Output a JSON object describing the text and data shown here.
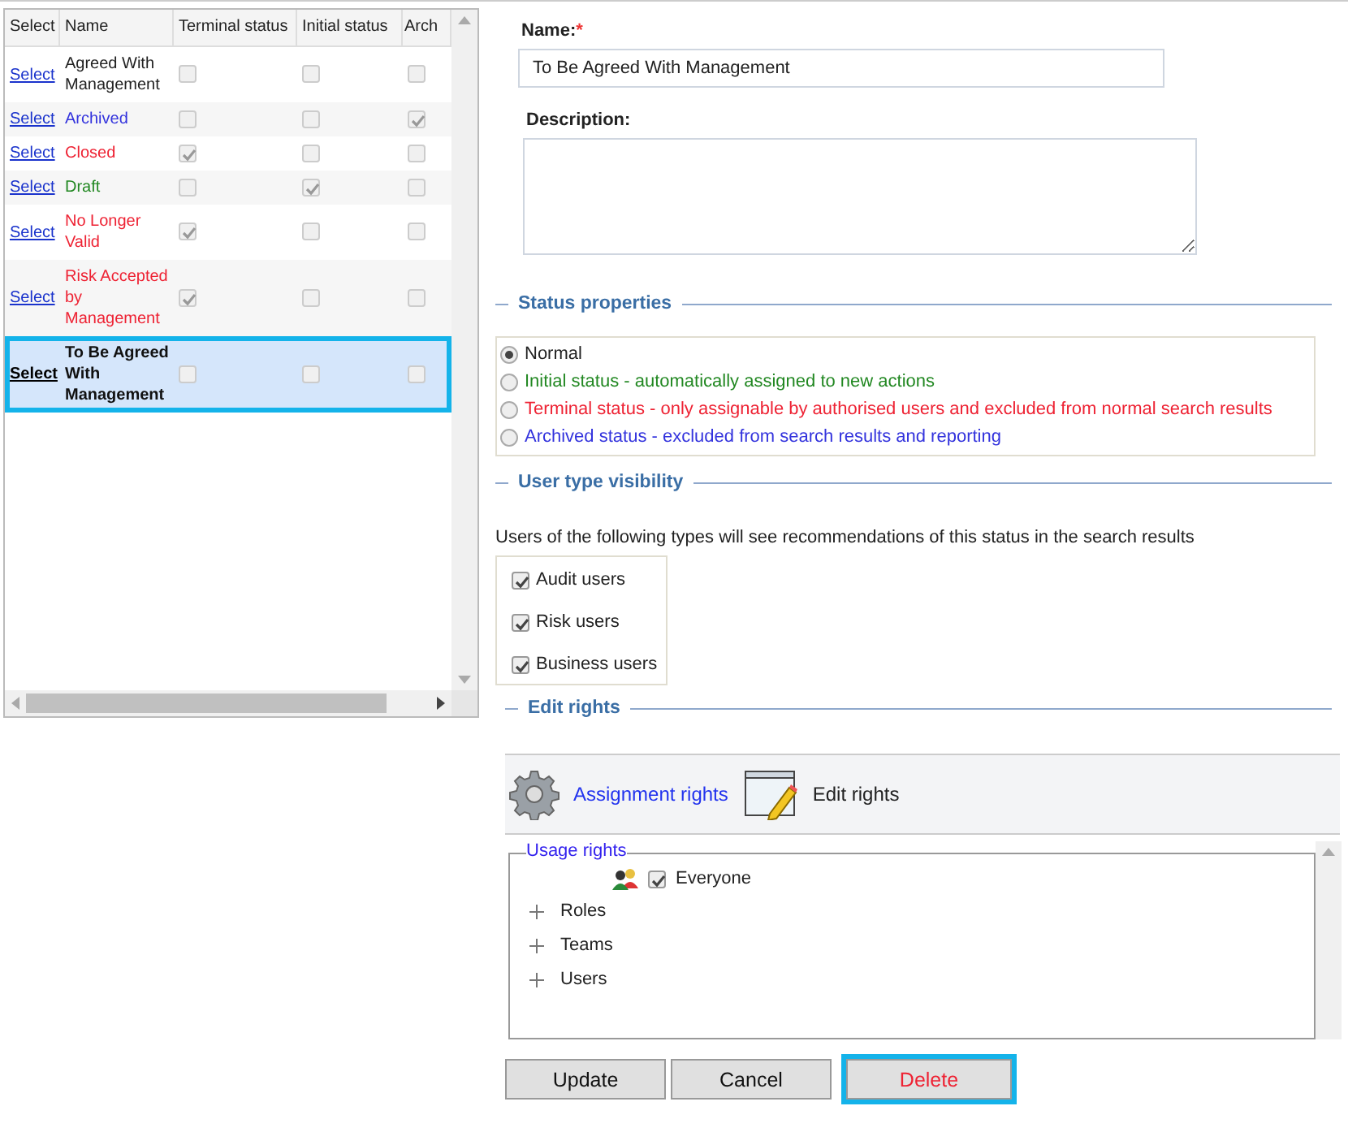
{
  "table": {
    "columns": [
      "Select",
      "Name",
      "Terminal status",
      "Initial status",
      "Arch"
    ],
    "rows": [
      {
        "link": "Select",
        "name": "Agreed With Management",
        "color": "#222222",
        "terminal": false,
        "initial": false,
        "archived": false,
        "selected": false
      },
      {
        "link": "Select",
        "name": "Archived",
        "color": "#3333dd",
        "terminal": false,
        "initial": false,
        "archived": true,
        "selected": false
      },
      {
        "link": "Select",
        "name": "Closed",
        "color": "#ee2233",
        "terminal": true,
        "initial": false,
        "archived": false,
        "selected": false
      },
      {
        "link": "Select",
        "name": "Draft",
        "color": "#228822",
        "terminal": false,
        "initial": true,
        "archived": false,
        "selected": false
      },
      {
        "link": "Select",
        "name": "No Longer Valid",
        "color": "#ee2233",
        "terminal": true,
        "initial": false,
        "archived": false,
        "selected": false
      },
      {
        "link": "Select",
        "name": "Risk Accepted by Management",
        "color": "#ee2233",
        "terminal": true,
        "initial": false,
        "archived": false,
        "selected": false
      },
      {
        "link": "Select",
        "name": "To Be Agreed With Management",
        "color": "#111111",
        "terminal": false,
        "initial": false,
        "archived": false,
        "selected": true
      }
    ]
  },
  "form": {
    "name_label": "Name:",
    "required_mark": "*",
    "name_value": "To Be Agreed With Management",
    "description_label": "Description:"
  },
  "status_properties": {
    "title": "Status properties",
    "options": [
      {
        "label": "Normal",
        "color": "#222222",
        "selected": true
      },
      {
        "label": "Initial status - automatically assigned to new actions",
        "color": "#228822",
        "selected": false
      },
      {
        "label": "Terminal status - only assignable by authorised users and excluded from normal search results",
        "color": "#ee2233",
        "selected": false
      },
      {
        "label": "Archived status - excluded from search results and reporting",
        "color": "#3333dd",
        "selected": false
      }
    ]
  },
  "user_type_visibility": {
    "title": "User type visibility",
    "description": "Users of the following types will see recommendations of this status in the search results",
    "user_types": [
      {
        "label": "Audit users",
        "checked": true
      },
      {
        "label": "Risk users",
        "checked": true
      },
      {
        "label": "Business users",
        "checked": true
      }
    ]
  },
  "edit_rights": {
    "title": "Edit rights",
    "tabs": [
      {
        "label": "Assignment rights",
        "selected": false
      },
      {
        "label": "Edit rights",
        "selected": true
      }
    ],
    "usage_rights": {
      "title": "Usage rights",
      "everyone": {
        "label": "Everyone",
        "checked": true
      },
      "groups": [
        {
          "label": "Roles",
          "expanded": false
        },
        {
          "label": "Teams",
          "expanded": false
        },
        {
          "label": "Users",
          "expanded": false
        }
      ]
    }
  },
  "buttons": [
    {
      "label": "Update",
      "kind": "normal"
    },
    {
      "label": "Cancel",
      "kind": "normal"
    },
    {
      "label": "Delete",
      "kind": "danger"
    }
  ]
}
